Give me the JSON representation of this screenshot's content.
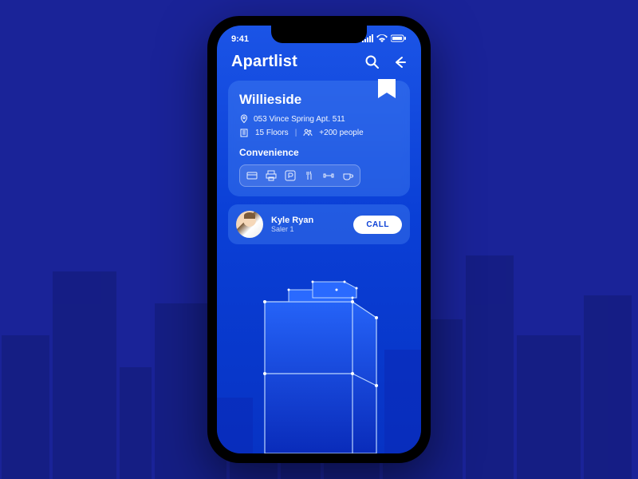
{
  "statusbar": {
    "time": "9:41"
  },
  "header": {
    "title": "Apartlist"
  },
  "listing": {
    "name": "Willieside",
    "address": "053 Vince Spring Apt. 511",
    "floors": "15 Floors",
    "people": "+200 people",
    "convenience_label": "Convenience"
  },
  "saler": {
    "name": "Kyle Ryan",
    "role": "Saler 1",
    "call_label": "CALL"
  }
}
